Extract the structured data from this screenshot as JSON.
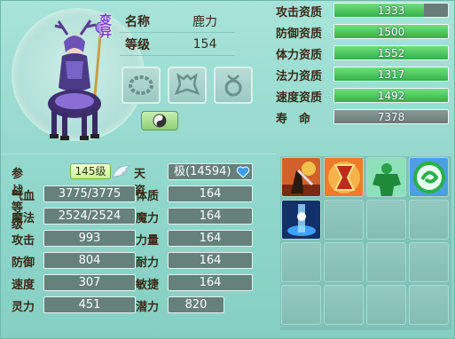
{
  "pet": {
    "morph_label": "变异",
    "name_label": "名称",
    "name_value": "鹿力",
    "level_label": "等级",
    "level_value": "154"
  },
  "aptitudes": [
    {
      "label": "攻击资质",
      "value": "1333",
      "fill": 0.79,
      "style": "green"
    },
    {
      "label": "防御资质",
      "value": "1500",
      "fill": 1.0,
      "style": "green"
    },
    {
      "label": "体力资质",
      "value": "1552",
      "fill": 1.0,
      "style": "green"
    },
    {
      "label": "法力资质",
      "value": "1317",
      "fill": 1.0,
      "style": "green"
    },
    {
      "label": "速度资质",
      "value": "1492",
      "fill": 1.0,
      "style": "green"
    },
    {
      "label": "寿　命",
      "value": "7378",
      "fill": 1.0,
      "style": "gray"
    }
  ],
  "battle_level": {
    "label": "参战等级",
    "value": "145级"
  },
  "talent": {
    "label": "天资",
    "value": "极(14594)"
  },
  "left_stats": [
    {
      "label": "气血",
      "value": "3775/3775"
    },
    {
      "label": "魔法",
      "value": "2524/2524"
    },
    {
      "label": "攻击",
      "value": "993"
    },
    {
      "label": "防御",
      "value": "804"
    },
    {
      "label": "速度",
      "value": "307"
    },
    {
      "label": "灵力",
      "value": "451"
    }
  ],
  "right_stats": [
    {
      "label": "体质",
      "value": "164"
    },
    {
      "label": "魔力",
      "value": "164"
    },
    {
      "label": "力量",
      "value": "164"
    },
    {
      "label": "耐力",
      "value": "164"
    },
    {
      "label": "敏捷",
      "value": "164"
    },
    {
      "label": "潜力",
      "value": "820"
    }
  ],
  "skills": [
    "skill-warrior",
    "skill-chalice",
    "skill-green-giant",
    "skill-green-swirl",
    "skill-blue-light",
    "",
    "",
    "",
    "",
    "",
    "",
    "",
    "",
    "",
    "",
    ""
  ],
  "colors": {
    "accent_green": "#35b04a",
    "panel_teal": "#8fd6cb",
    "box_gray": "#66807c",
    "morph_purple": "#7b3bd0"
  }
}
